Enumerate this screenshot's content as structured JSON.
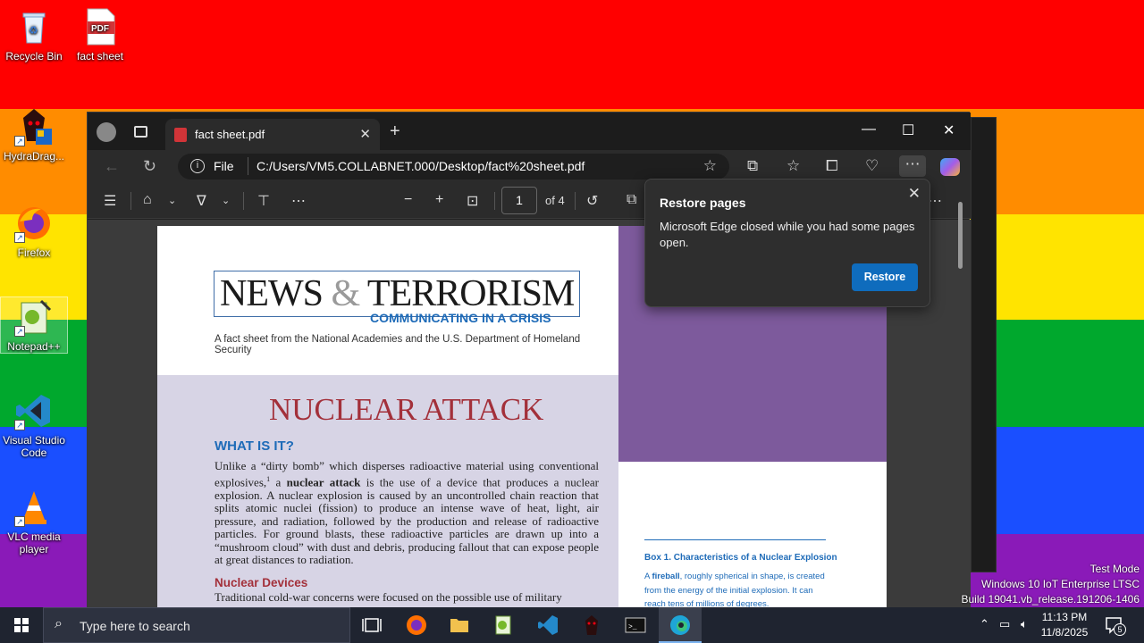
{
  "desktop": {
    "icons": [
      {
        "label": "Recycle Bin",
        "icon": "recycle-bin-icon"
      },
      {
        "label": "fact sheet",
        "icon": "pdf-file-icon",
        "badge": "PDF"
      },
      {
        "label": "HydraDrag...",
        "icon": "hydradragon-icon"
      },
      {
        "label": "Firefox",
        "icon": "firefox-icon"
      },
      {
        "label": "Notepad++",
        "icon": "notepad-plus-plus-icon"
      },
      {
        "label": "Visual Studio Code",
        "icon": "vscode-icon"
      },
      {
        "label": "VLC media player",
        "icon": "vlc-icon"
      }
    ],
    "watermark": {
      "line1": "Test Mode",
      "line2": "Windows 10 IoT Enterprise LTSC",
      "line3": "Build 19041.vb_release.191206-1406"
    }
  },
  "browser": {
    "tab": {
      "title": "fact sheet.pdf",
      "close": "✕"
    },
    "new_tab": "+",
    "window_controls": {
      "minimize": "—",
      "maximize": "☐",
      "close": "✕"
    },
    "address": {
      "scheme_label": "File",
      "url": "C:/Users/VM5.COLLABNET.000/Desktop/fact%20sheet.pdf"
    },
    "pdf_toolbar": {
      "page_number": "1",
      "page_total": "of 4"
    },
    "restore_popup": {
      "title": "Restore pages",
      "message": "Microsoft Edge closed while you had some pages open.",
      "button": "Restore"
    }
  },
  "document": {
    "logo_main": "NEWS",
    "logo_amp": "&",
    "logo_tail": "TERRORISM",
    "logo_subtitle": "COMMUNICATING IN A CRISIS",
    "fact_line": "A fact sheet from the National Academies and the U.S. Department of Homeland Security",
    "heading": "NUCLEAR ATTACK",
    "section1_title": "WHAT IS IT?",
    "section1_pre": "Unlike a “dirty bomb” which disperses radioactive material using conventional explosives,",
    "section1_sup": "1",
    "section1_mid": " a ",
    "section1_bold": "nuclear attack",
    "section1_post": " is the use of a device that produces a nuclear explosion. A nuclear explosion is caused by an uncontrolled chain reaction that splits atomic nuclei (fission) to produce an intense wave of heat, light, air pressure, and radiation, followed by the production and release of radioactive particles. For ground blasts, these radioactive particles are drawn up into a “mushroom cloud” with dust and debris, producing fallout that can expose people at great distances to radiation.",
    "section2_title": "Nuclear Devices",
    "section2_text": "Traditional cold-war concerns were focused on the possible use of military",
    "box_title": "Box 1. Characteristics of a Nuclear Explosion",
    "box_bold": "fireball",
    "box_pre": "A ",
    "box_post": ", roughly spherical in shape, is created from the energy of the initial explosion. It can reach tens of millions of degrees."
  },
  "taskbar": {
    "search_placeholder": "Type here to search",
    "time": "11:13 PM",
    "date": "11/8/2025",
    "notification_count": "5"
  }
}
